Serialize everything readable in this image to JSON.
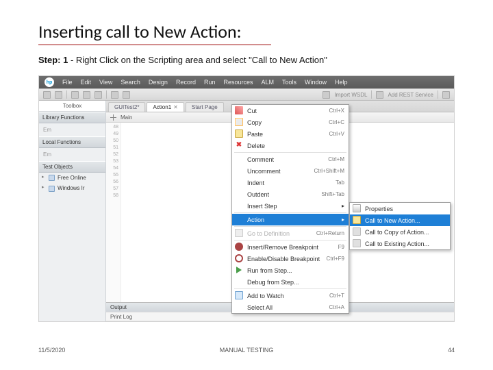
{
  "slide": {
    "title": "Inserting call to New Action:",
    "step_label": "Step: 1",
    "step_text": " - Right Click on the Scripting area and select \"Call to New Action\"",
    "date": "11/5/2020",
    "footer_mid": "MANUAL TESTING",
    "page_num": "44"
  },
  "app": {
    "menubar": [
      "File",
      "Edit",
      "View",
      "Search",
      "Design",
      "Record",
      "Run",
      "Resources",
      "ALM",
      "Tools",
      "Window",
      "Help"
    ],
    "toolbar": {
      "import_wsdl": "Import WSDL",
      "add_rest": "Add REST Service"
    },
    "sidebar": {
      "toolbox": "Toolbox",
      "sections": {
        "library": "Library Functions",
        "local": "Local Functions",
        "test_objects": "Test Objects"
      },
      "empty": "Em",
      "tree": {
        "free": "Free Online",
        "win": "Windows Ir"
      }
    },
    "tabs": {
      "t1": "GUITest2*",
      "t2": "Action1",
      "t3": "Start Page"
    },
    "main_label": "Main",
    "gutter_lines": [
      "48",
      "49",
      "50",
      "51",
      "52",
      "53",
      "54",
      "55",
      "56",
      "57",
      "58"
    ],
    "output_hdr": "Output",
    "output_sub": "Print Log"
  },
  "ctx": {
    "cut": "Cut",
    "cut_s": "Ctrl+X",
    "copy": "Copy",
    "copy_s": "Ctrl+C",
    "paste": "Paste",
    "paste_s": "Ctrl+V",
    "delete": "Delete",
    "comment": "Comment",
    "comment_s": "Ctrl+M",
    "uncomment": "Uncomment",
    "uncomment_s": "Ctrl+Shift+M",
    "indent": "Indent",
    "indent_s": "Tab",
    "outdent": "Outdent",
    "outdent_s": "Shift+Tab",
    "insert_step": "Insert Step",
    "action": "Action",
    "goto_def": "Go to Definition",
    "goto_def_s": "Ctrl+Return",
    "bp_insert": "Insert/Remove Breakpoint",
    "bp_insert_s": "F9",
    "bp_toggle": "Enable/Disable Breakpoint",
    "bp_toggle_s": "Ctrl+F9",
    "run_from": "Run from Step...",
    "debug_from": "Debug from Step...",
    "add_watch": "Add to Watch",
    "add_watch_s": "Ctrl+T",
    "select_all": "Select All",
    "select_all_s": "Ctrl+A"
  },
  "sub": {
    "properties": "Properties",
    "call_new": "Call to New Action...",
    "call_copy": "Call to Copy of Action...",
    "call_existing": "Call to Existing Action..."
  }
}
